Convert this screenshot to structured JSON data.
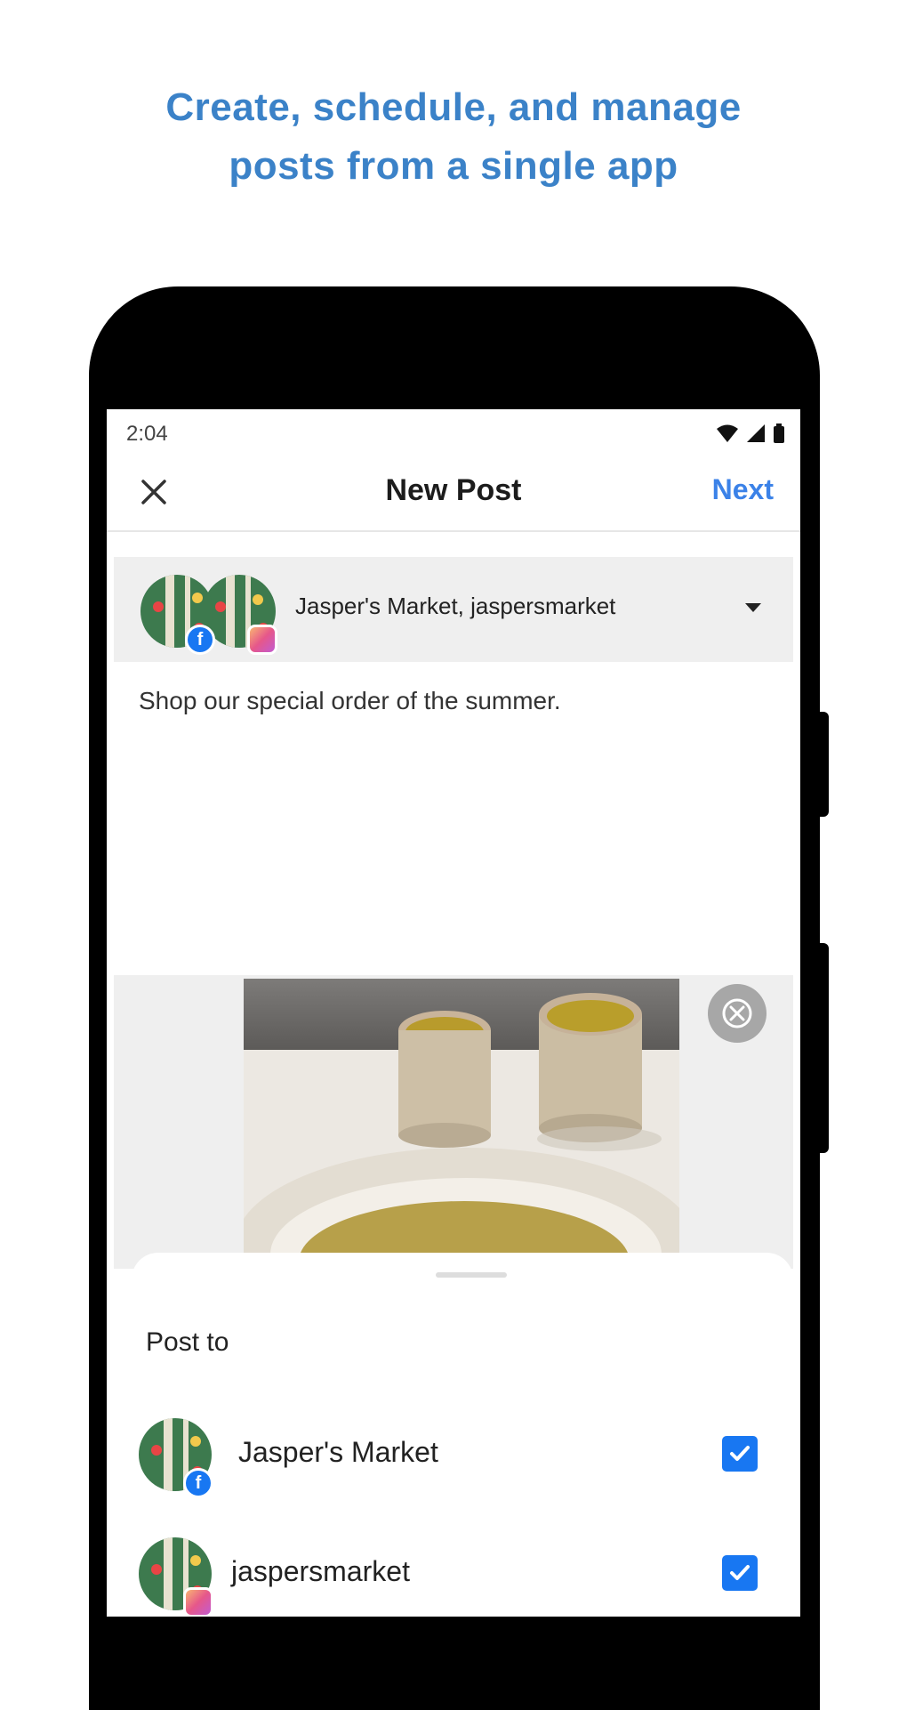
{
  "headline": {
    "line1": "Create, schedule, and manage",
    "line2": "posts from a single app"
  },
  "status_bar": {
    "time": "2:04"
  },
  "app_bar": {
    "title": "New Post",
    "next_label": "Next"
  },
  "account_selector": {
    "names": "Jasper's Market, jaspersmarket"
  },
  "composer": {
    "text": "Shop our special order of the summer."
  },
  "post_to": {
    "title": "Post to",
    "accounts": [
      {
        "label": "Jasper's Market",
        "network": "facebook",
        "checked": true
      },
      {
        "label": "jaspersmarket",
        "network": "instagram",
        "checked": true
      }
    ]
  },
  "colors": {
    "accent": "#3b82e8",
    "headline": "#3b82c8",
    "facebook": "#1877f2"
  }
}
